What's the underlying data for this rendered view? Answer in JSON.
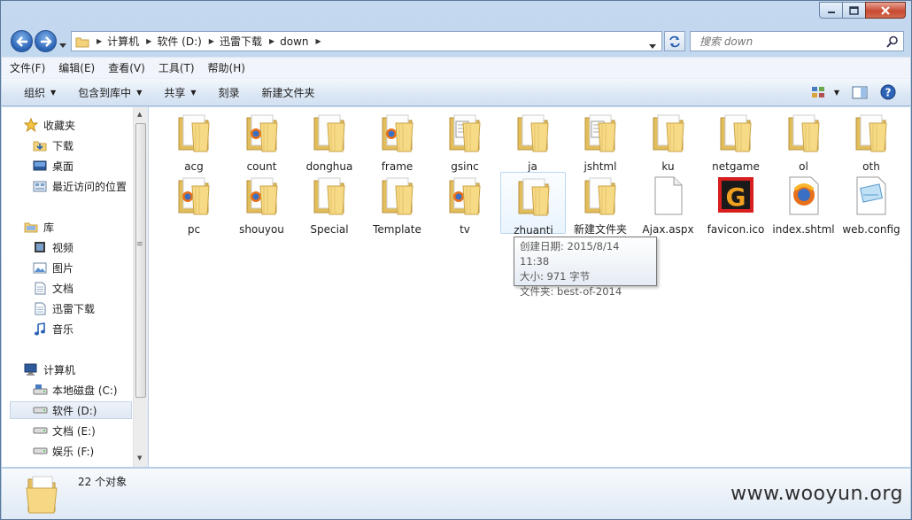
{
  "window": {
    "minimize_icon": "minimize-icon",
    "maximize_icon": "maximize-icon",
    "close_icon": "close-icon"
  },
  "address": {
    "crumbs": [
      "计算机",
      "软件 (D:)",
      "迅雷下载",
      "down"
    ],
    "search_placeholder": "搜索 down"
  },
  "menu": [
    "文件(F)",
    "编辑(E)",
    "查看(V)",
    "工具(T)",
    "帮助(H)"
  ],
  "toolbar": {
    "organize": "组织",
    "include_in_library": "包含到库中",
    "share": "共享",
    "burn": "刻录",
    "new_folder": "新建文件夹"
  },
  "nav": {
    "favorites": "收藏夹",
    "downloads": "下载",
    "desktop": "桌面",
    "recent": "最近访问的位置",
    "libraries": "库",
    "videos": "视频",
    "pictures": "图片",
    "documents": "文档",
    "xunlei": "迅雷下载",
    "music": "音乐",
    "computer": "计算机",
    "drive_c": "本地磁盘 (C:)",
    "drive_d": "软件 (D:)",
    "drive_e": "文档 (E:)",
    "drive_f": "娱乐 (F:)"
  },
  "items": [
    {
      "name": "acg",
      "type": "folder"
    },
    {
      "name": "count",
      "type": "folder-ff"
    },
    {
      "name": "donghua",
      "type": "folder"
    },
    {
      "name": "frame",
      "type": "folder-ff"
    },
    {
      "name": "gsinc",
      "type": "folder-doc"
    },
    {
      "name": "ja",
      "type": "folder"
    },
    {
      "name": "jshtml",
      "type": "folder-doc"
    },
    {
      "name": "ku",
      "type": "folder"
    },
    {
      "name": "netgame",
      "type": "folder"
    },
    {
      "name": "ol",
      "type": "folder"
    },
    {
      "name": "oth",
      "type": "folder"
    },
    {
      "name": "pc",
      "type": "folder-ff"
    },
    {
      "name": "shouyou",
      "type": "folder-ff"
    },
    {
      "name": "Special",
      "type": "folder"
    },
    {
      "name": "Template",
      "type": "folder"
    },
    {
      "name": "tv",
      "type": "folder-ff"
    },
    {
      "name": "zhuanti",
      "type": "folder"
    },
    {
      "name": "新建文件夹",
      "type": "folder"
    },
    {
      "name": "Ajax.aspx",
      "type": "file"
    },
    {
      "name": "favicon.ico",
      "type": "ico"
    },
    {
      "name": "index.shtml",
      "type": "firefox"
    },
    {
      "name": "web.config",
      "type": "config"
    }
  ],
  "tooltip": {
    "created": "创建日期: 2015/8/14 11:38",
    "size": "大小: 971 字节",
    "folder": "文件夹: best-of-2014"
  },
  "status": {
    "count": "22 个对象"
  },
  "watermark": "www.wooyun.org",
  "colors": {
    "folder": "#f2d27a",
    "accent": "#2a62b4",
    "close": "#c84a32"
  }
}
